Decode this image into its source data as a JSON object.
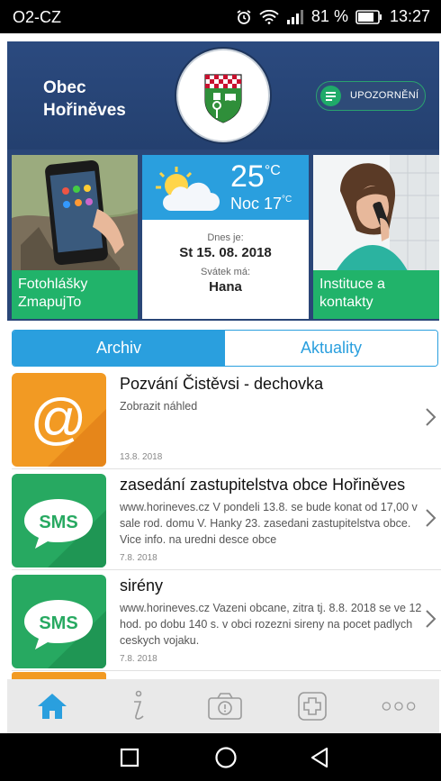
{
  "status_bar": {
    "carrier": "O2-CZ",
    "battery": "81 %",
    "time": "13:27"
  },
  "header": {
    "village_line1": "Obec",
    "village_line2": "Hořiněves",
    "notify_label": "UPOZORNĚNÍ"
  },
  "tiles": {
    "photo_caption_line1": "Fotohlášky",
    "photo_caption_line2": "ZmapujTo",
    "weather": {
      "temp": "25",
      "unit": "°C",
      "night_label": "Noc 17",
      "night_unit": "°C",
      "today_label": "Dnes je:",
      "date": "St 15. 08. 2018",
      "nameday_label": "Svátek má:",
      "nameday": "Hana"
    },
    "contacts_caption_line1": "Instituce a",
    "contacts_caption_line2": "kontakty"
  },
  "tabs": [
    {
      "label": "Archiv",
      "active": true
    },
    {
      "label": "Aktuality",
      "active": false
    }
  ],
  "news": [
    {
      "icon": "at-icon",
      "title": "Pozvání Čistěvsi - dechovka",
      "desc": "Zobrazit náhled",
      "date": "13.8. 2018"
    },
    {
      "icon": "sms-icon",
      "title": "zasedání zastupitelstva obce Hořiněves",
      "desc": "www.horineves.cz V pondeli 13.8. se bude  konat od 17,00  v sale rod. domu V. Hanky 23. zasedani zastupitelstva obce. Vice info. na uredni desce obce",
      "date": "7.8. 2018"
    },
    {
      "icon": "sms-icon",
      "title": "sirény",
      "desc": "www.horineves.cz Vazeni obcane, zitra tj. 8.8. 2018 se ve 12 hod. po dobu 140 s. v obci rozezni sireny na pocet padlych ceskych vojaku.",
      "date": "7.8. 2018"
    }
  ],
  "bottom_nav": [
    "home-icon",
    "info-icon",
    "camera-icon",
    "first-aid-icon",
    "more-icon"
  ],
  "colors": {
    "header_blue": "#2b4a7f",
    "accent_blue": "#2a9fde",
    "green": "#21b36a",
    "orange": "#f29a23"
  }
}
